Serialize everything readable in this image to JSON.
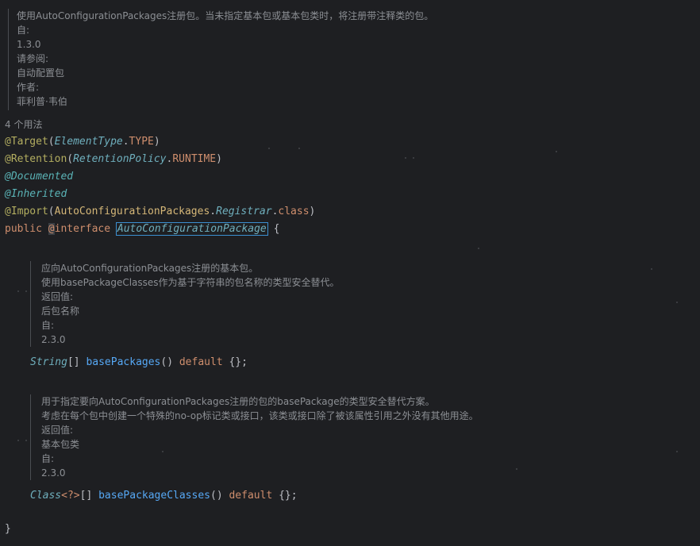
{
  "doc_top": {
    "lines": [
      "使用AutoConfigurationPackages注册包。当未指定基本包或基本包类时，将注册带注释类的包。",
      "自:",
      "1.3.0",
      "请参阅:",
      "自动配置包",
      "作者:",
      "菲利普·韦伯"
    ]
  },
  "usage_hint": "4 个用法",
  "code": {
    "target": {
      "annotation": "@Target",
      "open": "(",
      "type": "ElementType",
      "dot": ".",
      "value": "TYPE",
      "close": ")"
    },
    "retention": {
      "annotation": "@Retention",
      "open": "(",
      "type": "RetentionPolicy",
      "dot": ".",
      "value": "RUNTIME",
      "close": ")"
    },
    "documented": "@Documented",
    "inherited": "@Inherited",
    "import": {
      "annotation": "@Import",
      "open": "(",
      "cls": "AutoConfigurationPackages",
      "dot1": ".",
      "inner": "Registrar",
      "dot2": ".",
      "kw": "class",
      "close": ")"
    },
    "decl": {
      "public": "public",
      "at": "@",
      "interface": "interface",
      "name": "AutoConfigurationPackage",
      "brace": "{"
    },
    "method1": {
      "type": "String",
      "arr": "[]",
      "name": "basePackages",
      "parens": "()",
      "default": "default",
      "value": "{};"
    },
    "method2": {
      "type": "Class",
      "generic": "<?>",
      "arr": "[]",
      "name": "basePackageClasses",
      "parens": "()",
      "default": "default",
      "value": "{};"
    },
    "close_brace": "}"
  },
  "doc_method1": {
    "lines": [
      "应向AutoConfigurationPackages注册的基本包。",
      "使用basePackageClasses作为基于字符串的包名称的类型安全替代。",
      "返回值:",
      "后包名称",
      "自:",
      "2.3.0"
    ]
  },
  "doc_method2": {
    "lines": [
      "用于指定要向AutoConfigurationPackages注册的包的basePackage的类型安全替代方案。",
      "考虑在每个包中创建一个特殊的no-op标记类或接口，该类或接口除了被该属性引用之外没有其他用途。",
      "返回值:",
      "基本包类",
      "自:",
      "2.3.0"
    ]
  }
}
